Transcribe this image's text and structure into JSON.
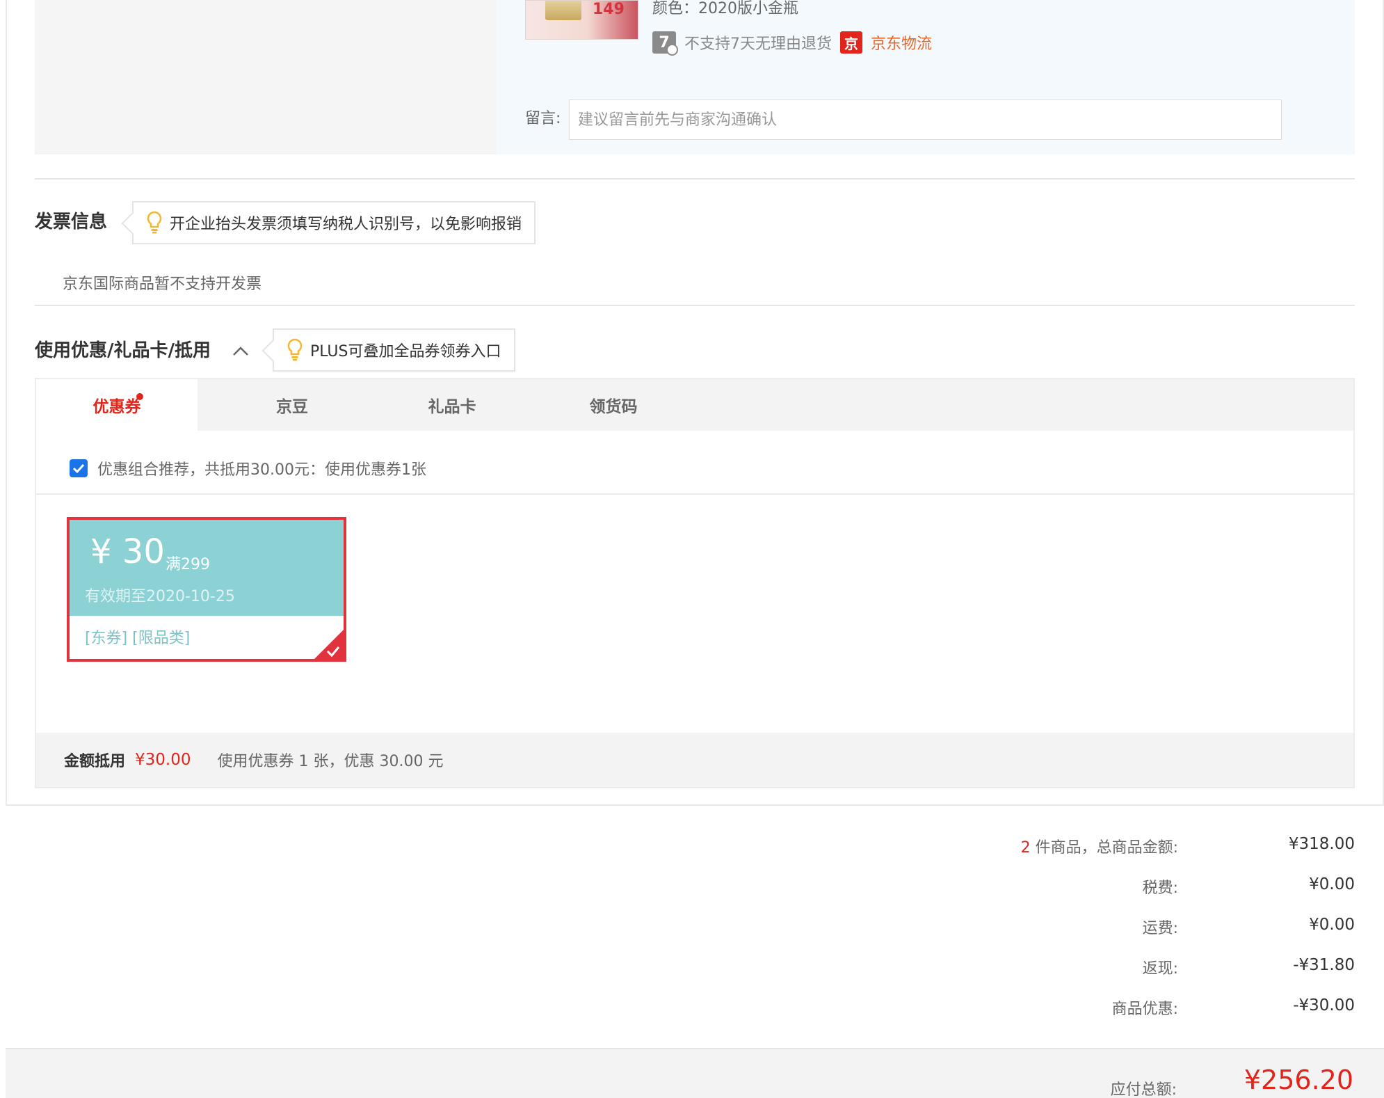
{
  "product": {
    "thumb_price": "149",
    "color_label": "颜色：2020版小金瓶",
    "return_badge": "7",
    "return_text": "不支持7天无理由退货",
    "jd_badge": "京",
    "logistics_text": "京东物流",
    "message_label": "留言:",
    "message_placeholder": "建议留言前先与商家沟通确认"
  },
  "invoice": {
    "title": "发票信息",
    "tip": "开企业抬头发票须填写纳税人识别号，以免影响报销",
    "note": "京东国际商品暂不支持开发票"
  },
  "discount": {
    "title": "使用优惠/礼品卡/抵用",
    "tip": "PLUS可叠加全品券领券入口",
    "tabs": [
      {
        "label": "优惠券"
      },
      {
        "label": "京豆"
      },
      {
        "label": "礼品卡"
      },
      {
        "label": "领货码"
      }
    ],
    "recommend_text": "优惠组合推荐，共抵用30.00元：使用优惠券1张",
    "coupon": {
      "amount": "¥ 30",
      "condition": "满299",
      "valid": "有效期至2020-10-25",
      "tags": "[东券]  [限品类]"
    },
    "summary": {
      "label": "金额抵用",
      "amount": "¥30.00",
      "desc": "使用优惠券 1 张，优惠 30.00 元"
    }
  },
  "totals": {
    "item_count": "2",
    "goods_label": " 件商品，总商品金额:",
    "goods_value": "¥318.00",
    "tax_label": "税费:",
    "tax_value": "¥0.00",
    "shipping_label": "运费:",
    "shipping_value": "¥0.00",
    "cashback_label": "返现:",
    "cashback_value": "-¥31.80",
    "promo_label": "商品优惠:",
    "promo_value": "-¥30.00",
    "payable_label": "应付总额:",
    "payable_value": "¥256.20"
  },
  "colors": {
    "accent_red": "#e1251b",
    "coupon_teal": "#8cd1d4",
    "logistics_orange": "#e4682a"
  }
}
